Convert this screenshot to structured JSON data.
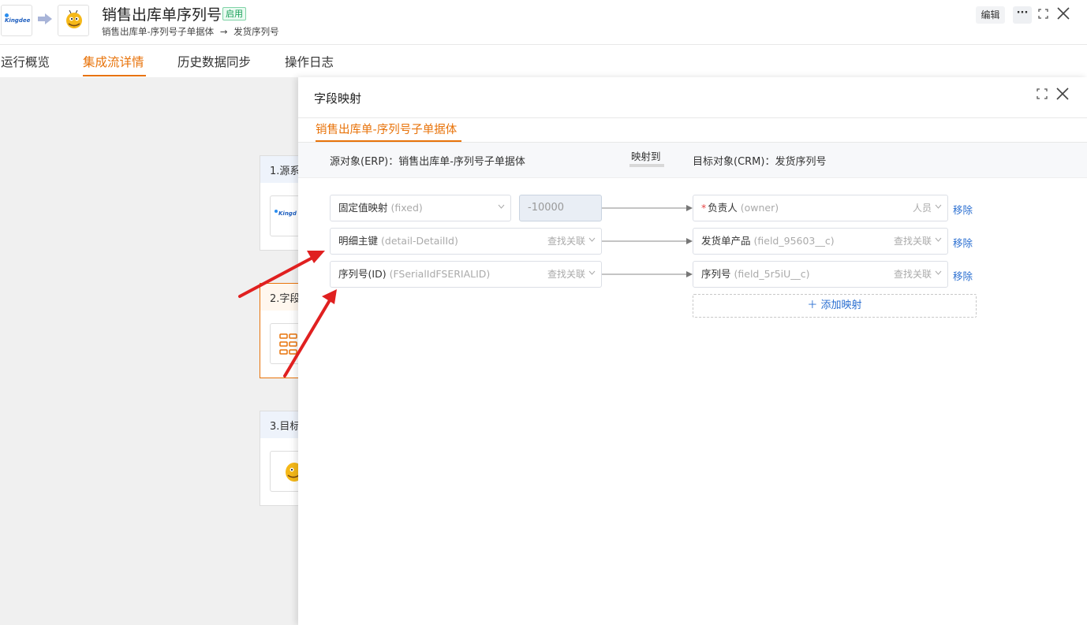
{
  "header": {
    "title": "销售出库单序列号",
    "status_badge": "启用",
    "source_name": "销售出库单-序列号子单据体",
    "arrow": "→",
    "target_name": "发货序列号",
    "kingdee_logo_text": "Kingdee",
    "edit_label": "编辑",
    "more_label": "···"
  },
  "tabs": [
    {
      "label": "运行概览"
    },
    {
      "label": "集成流详情"
    },
    {
      "label": "历史数据同步"
    },
    {
      "label": "操作日志"
    }
  ],
  "steps": [
    {
      "label": "1.源系"
    },
    {
      "label": "2.字段"
    },
    {
      "label": "3.目标"
    }
  ],
  "drawer": {
    "title": "字段映射",
    "tab": "销售出库单-序列号子单据体",
    "source_object": "源对象(ERP)：销售出库单-序列号子单据体",
    "map_to": "映射到",
    "target_object": "目标对象(CRM)：发货序列号",
    "rows": [
      {
        "source_label": "固定值映射",
        "source_code": "(fixed)",
        "source_hint": "",
        "constant": "-10000",
        "target_required": "*",
        "target_label": "负责人",
        "target_code": "(owner)",
        "target_hint": "人员",
        "remove": "移除"
      },
      {
        "source_label": "明细主键",
        "source_code": "(detail-DetailId)",
        "source_hint": "查找关联",
        "target_label": "发货单产品",
        "target_code": "(field_95603__c)",
        "target_hint": "查找关联",
        "remove": "移除"
      },
      {
        "source_label": "序列号(ID)",
        "source_code": "(FSerialIdFSERIALID)",
        "source_hint": "查找关联",
        "target_label": "序列号",
        "target_code": "(field_5r5iU__c)",
        "target_hint": "查找关联",
        "remove": "移除"
      }
    ],
    "add_mapping": "＋ 添加映射"
  },
  "colors": {
    "accent": "#e8730a",
    "link": "#2b6fd1",
    "badge_green": "#18a058",
    "annotation_red": "#e02020"
  }
}
